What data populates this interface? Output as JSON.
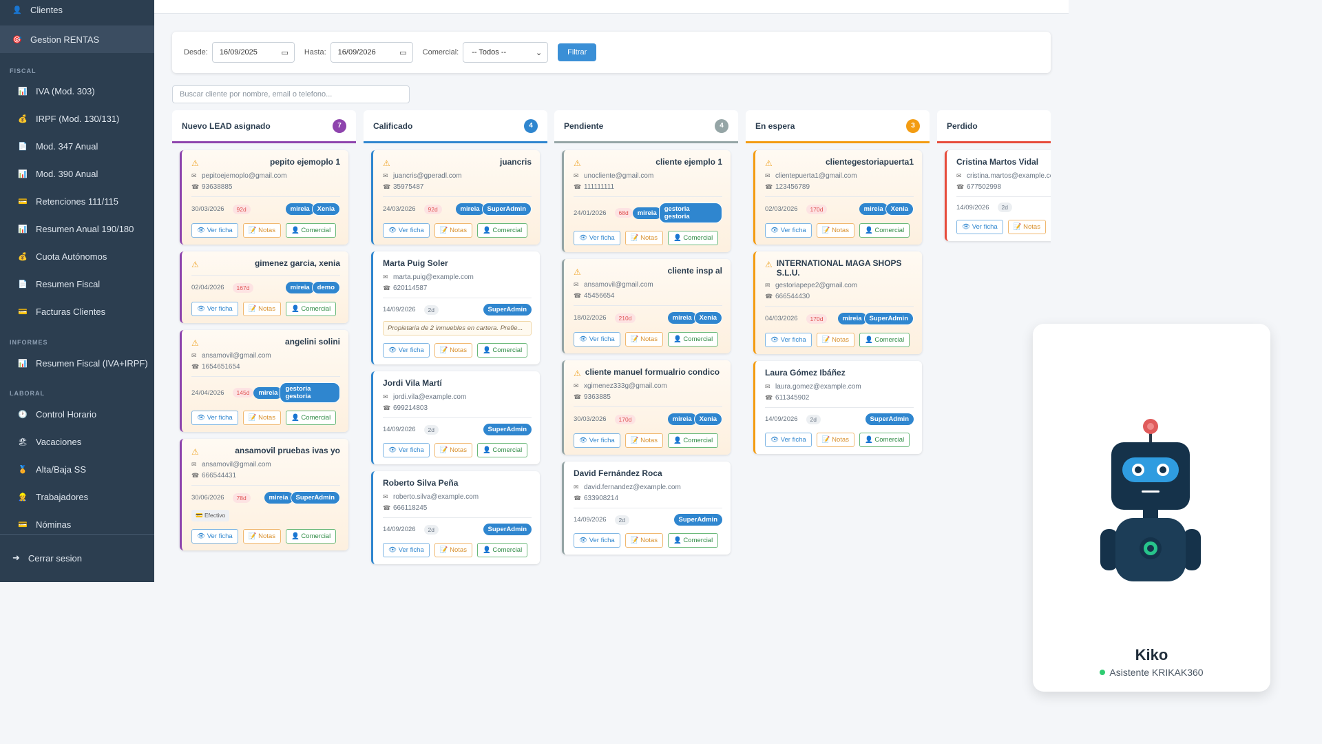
{
  "sidebar": {
    "items": [
      {
        "label": "Clientes",
        "icon": "user-icon"
      },
      {
        "label": "Gestion RENTAS",
        "icon": "target-icon"
      },
      {
        "label": "IVA (Mod. 303)",
        "icon": "chart-icon"
      },
      {
        "label": "IRPF (Mod. 130/131)",
        "icon": "moneybag-icon"
      },
      {
        "label": "Mod. 347 Anual",
        "icon": "doc-icon"
      },
      {
        "label": "Mod. 390 Anual",
        "icon": "chart-icon"
      },
      {
        "label": "Retenciones 111/115",
        "icon": "card-icon"
      },
      {
        "label": "Resumen Anual 190/180",
        "icon": "chart-icon"
      },
      {
        "label": "Cuota Autónomos",
        "icon": "moneybag-icon"
      },
      {
        "label": "Resumen Fiscal",
        "icon": "doc-icon"
      },
      {
        "label": "Facturas Clientes",
        "icon": "card-icon"
      },
      {
        "label": "Resumen Fiscal (IVA+IRPF)",
        "icon": "chart-icon"
      },
      {
        "label": "Control Horario",
        "icon": "clock-icon"
      },
      {
        "label": "Vacaciones",
        "icon": "beach-icon"
      },
      {
        "label": "Alta/Baja SS",
        "icon": "badge-icon"
      },
      {
        "label": "Trabajadores",
        "icon": "worker-icon"
      },
      {
        "label": "Nóminas",
        "icon": "card-icon"
      }
    ],
    "sections": {
      "fiscal": "FISCAL",
      "informes": "INFORMES",
      "laboral": "LABORAL"
    },
    "logout": "Cerrar sesion"
  },
  "filters": {
    "desde_label": "Desde:",
    "desde_value": "16/09/2025",
    "hasta_label": "Hasta:",
    "hasta_value": "16/09/2026",
    "comercial_label": "Comercial:",
    "comercial_value": "-- Todos --",
    "button": "Filtrar"
  },
  "search": {
    "placeholder": "Buscar cliente por nombre, email o telefono..."
  },
  "actions": {
    "ver": "👁 Ver ficha",
    "notas": "📝 Notas",
    "comercial": "👤 Comercial"
  },
  "columns": [
    {
      "title": "Nuevo LEAD asignado",
      "count": "7",
      "color": "#8e44ad",
      "badge": "#8e44ad",
      "cards": [
        {
          "name": "pepito ejemoplo 1",
          "warn": true,
          "email": "pepitoejemoplo@gmail.com",
          "phone": "93638885",
          "date": "30/03/2026",
          "age": "92d",
          "tags": [
            "mireia",
            "Xenia"
          ]
        },
        {
          "name": "gimenez garcia, xenia",
          "warn": true,
          "date": "02/04/2026",
          "age": "167d",
          "tags": [
            "mireia",
            "demo"
          ]
        },
        {
          "name": "angelini solini",
          "warn": true,
          "email": "ansamovil@gmail.com",
          "phone": "1654651654",
          "date": "24/04/2026",
          "age": "145d",
          "tags": [
            "mireia",
            "gestoria gestoria"
          ]
        },
        {
          "name": "ansamovil pruebas ivas yo",
          "warn": true,
          "email": "ansamovil@gmail.com",
          "phone": "666544431",
          "date": "30/06/2026",
          "age": "78d",
          "tags": [
            "mireia",
            "SuperAdmin"
          ],
          "pay": "💳 Efectivo"
        }
      ]
    },
    {
      "title": "Calificado",
      "count": "4",
      "color": "#2f86cf",
      "badge": "#2f86cf",
      "cards": [
        {
          "name": "juancris",
          "warn": true,
          "email": "juancris@gperadl.com",
          "phone": "35975487",
          "date": "24/03/2026",
          "age": "92d",
          "tags": [
            "mireia",
            "SuperAdmin"
          ]
        },
        {
          "name": "Marta Puig Soler",
          "email": "marta.puig@example.com",
          "phone": "620114587",
          "date": "14/09/2026",
          "age": "2d",
          "fresh": true,
          "tags": [
            "SuperAdmin"
          ],
          "note": "Propietaria de 2 inmuebles en cartera. Prefie..."
        },
        {
          "name": "Jordi Vila Martí",
          "email": "jordi.vila@example.com",
          "phone": "699214803",
          "date": "14/09/2026",
          "age": "2d",
          "fresh": true,
          "tags": [
            "SuperAdmin"
          ]
        },
        {
          "name": "Roberto Silva Peña",
          "email": "roberto.silva@example.com",
          "phone": "666118245",
          "date": "14/09/2026",
          "age": "2d",
          "fresh": true,
          "tags": [
            "SuperAdmin"
          ]
        }
      ]
    },
    {
      "title": "Pendiente",
      "count": "4",
      "color": "#95a5a6",
      "badge": "#95a5a6",
      "cards": [
        {
          "name": "cliente ejemplo 1",
          "warn": true,
          "email": "unocliente@gmail.com",
          "phone": "111111111",
          "date": "24/01/2026",
          "age": "68d",
          "tags": [
            "mireia",
            "gestoria gestoria"
          ]
        },
        {
          "name": "cliente insp al",
          "warn": true,
          "email": "ansamovil@gmail.com",
          "phone": "45456654",
          "date": "18/02/2026",
          "age": "210d",
          "tags": [
            "mireia",
            "Xenia"
          ]
        },
        {
          "name": "cliente manuel formualrio condico",
          "warn": true,
          "email": "xgimenez333g@gmail.com",
          "phone": "9363885",
          "date": "30/03/2026",
          "age": "170d",
          "tags": [
            "mireia",
            "Xenia"
          ]
        },
        {
          "name": "David Fernández Roca",
          "email": "david.fernandez@example.com",
          "phone": "633908214",
          "date": "14/09/2026",
          "age": "2d",
          "fresh": true,
          "tags": [
            "SuperAdmin"
          ]
        }
      ]
    },
    {
      "title": "En espera",
      "count": "3",
      "color": "#f39c12",
      "badge": "#f39c12",
      "cards": [
        {
          "name": "clientegestoriapuerta1",
          "warn": true,
          "email": "clientepuerta1@gmail.com",
          "phone": "123456789",
          "date": "02/03/2026",
          "age": "170d",
          "tags": [
            "mireia",
            "Xenia"
          ]
        },
        {
          "name": "INTERNATIONAL MAGA SHOPS S.L.U.",
          "warn": true,
          "email": "gestoriapepe2@gmail.com",
          "phone": "666544430",
          "date": "04/03/2026",
          "age": "170d",
          "tags": [
            "mireia",
            "SuperAdmin"
          ]
        },
        {
          "name": "Laura Gómez Ibáñez",
          "email": "laura.gomez@example.com",
          "phone": "611345902",
          "date": "14/09/2026",
          "age": "2d",
          "fresh": true,
          "tags": [
            "SuperAdmin"
          ]
        }
      ]
    },
    {
      "title": "Perdido",
      "count": "",
      "color": "#e74c3c",
      "badge": "#e74c3c",
      "cards": [
        {
          "name": "Cristina Martos Vidal",
          "email": "cristina.martos@example.com",
          "phone": "677502998",
          "date": "14/09/2026",
          "age": "2d",
          "fresh": true,
          "tags": []
        }
      ]
    }
  ],
  "bot": {
    "name": "Kiko",
    "subtitle": "Asistente KRIKAK360"
  }
}
